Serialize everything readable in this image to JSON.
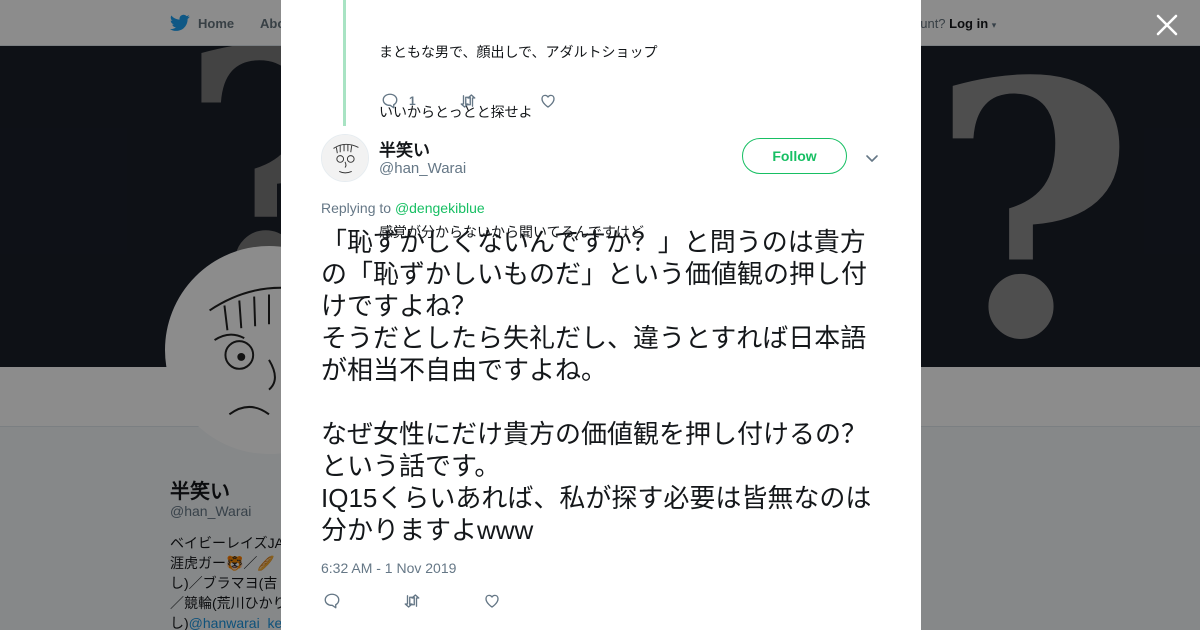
{
  "nav": {
    "home_label": "Home",
    "about_label": "Abo",
    "account_prompt": "ccount?",
    "login_label": "Log in"
  },
  "profile": {
    "name": "半笑い",
    "handle": "@han_Warai",
    "bio_lines": [
      "ベイビーレイズJA",
      "涯虎ガー🐯／🥖",
      "し)／ブラマヨ(吉",
      "／競輪(荒川ひかり"
    ],
    "bio_last_prefix": "し)",
    "bio_last_link": "@hanwarai_ke"
  },
  "previous_tweet": {
    "text_lines": [
      "まともな男で、顔出しで、アダルトショップ",
      "いいからとっとと探せよ",
      "",
      "感覚が分からないから聞いてるんですけど"
    ],
    "reply_count": "1",
    "retweet_count": "",
    "like_count": ""
  },
  "tweet": {
    "author_name": "半笑い",
    "author_handle": "@han_Warai",
    "follow_label": "Follow",
    "replying_prefix": "Replying to",
    "replying_handle": "@dengekiblue",
    "body": "「恥ずかしくないんですか？」と問うのは貴方の「恥ずかしいものだ」という価値観の押し付けですよね？\nそうだとしたら失礼だし、違うとすれば日本語が相当不自由ですよね。\n\nなぜ女性にだけ貴方の価値観を押し付けるの？という話です。\nIQ15くらいあれば、私が探す必要は皆無なのは分かりますよwww",
    "timestamp": "6:32 AM - 1 Nov 2019",
    "reply_count": "",
    "retweet_count": "",
    "like_count": ""
  },
  "colors": {
    "accent_green": "#17bf63",
    "twitter_blue": "#1da1f2",
    "thread_line": "#a8e3c3",
    "muted_text": "#657786"
  },
  "icons": {
    "brand": "twitter-bird-icon",
    "close": "close-icon",
    "reply": "reply-icon",
    "retweet": "retweet-icon",
    "like": "heart-icon",
    "more": "chevron-down-icon"
  }
}
